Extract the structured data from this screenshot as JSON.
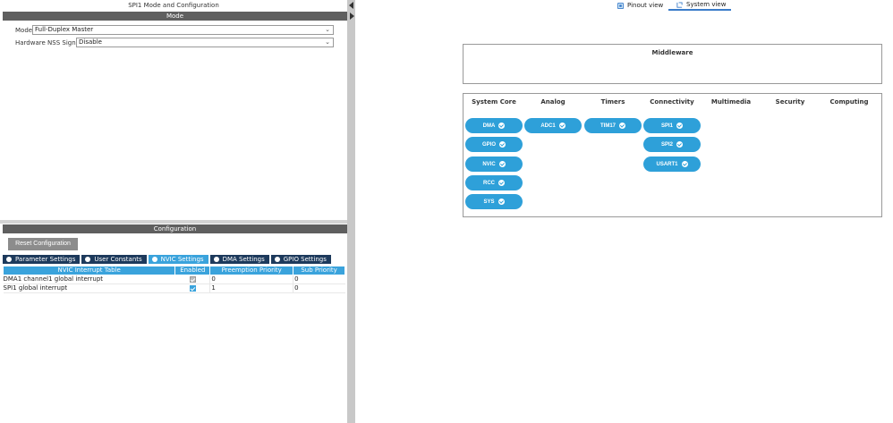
{
  "left_panel": {
    "title": "SPI1 Mode and Configuration",
    "mode_header": "Mode",
    "mode_label": "Mode",
    "mode_value": "Full-Duplex Master",
    "nss_label": "Hardware NSS Signal",
    "nss_value": "Disable",
    "config_header": "Configuration",
    "reset_button": "Reset Configuration",
    "tabs": [
      {
        "label": "Parameter Settings",
        "active": false
      },
      {
        "label": "User Constants",
        "active": false
      },
      {
        "label": "NVIC Settings",
        "active": true
      },
      {
        "label": "DMA Settings",
        "active": false
      },
      {
        "label": "GPIO Settings",
        "active": false
      }
    ],
    "table": {
      "headers": [
        "NVIC Interrupt Table",
        "Enabled",
        "Preemption Priority",
        "Sub Priority"
      ],
      "rows": [
        {
          "name": "DMA1 channel1 global interrupt",
          "enabled": true,
          "enabled_style": "grey",
          "preemption": "0",
          "sub": "0"
        },
        {
          "name": "SPI1 global interrupt",
          "enabled": true,
          "enabled_style": "blue",
          "preemption": "1",
          "sub": "0"
        }
      ]
    }
  },
  "right_panel": {
    "view_tabs": [
      {
        "label": "Pinout view",
        "active": false,
        "icon": "pinout-icon"
      },
      {
        "label": "System view",
        "active": true,
        "icon": "system-icon"
      }
    ],
    "middleware_title": "Middleware",
    "categories": [
      "System Core",
      "Analog",
      "Timers",
      "Connectivity",
      "Multimedia",
      "Security",
      "Computing"
    ],
    "buttons": {
      "system_core": [
        "DMA",
        "GPIO",
        "NVIC",
        "RCC",
        "SYS"
      ],
      "analog": [
        "ADC1"
      ],
      "timers": [
        "TIM17"
      ],
      "connectivity": [
        "SPI1",
        "SPI2",
        "USART1"
      ]
    }
  },
  "colors": {
    "accent_blue": "#2ea0d9",
    "tab_dark": "#1d3a5c",
    "header_gray": "#5f5f5f"
  }
}
